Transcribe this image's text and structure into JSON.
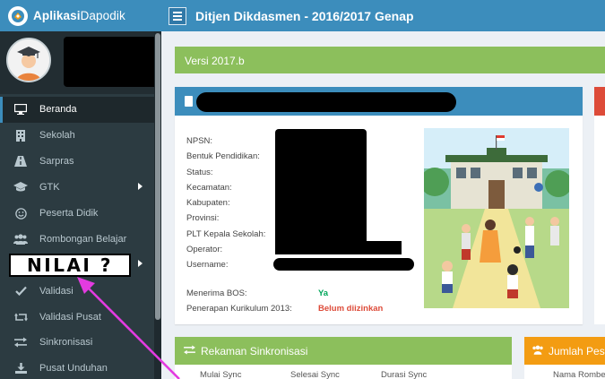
{
  "app": {
    "logo_bold": "Aplikasi",
    "logo_rest": "Dapodik",
    "page_title": "Ditjen Dikdasmen - 2016/2017 Genap"
  },
  "sidebar": {
    "items": [
      {
        "label": "Beranda",
        "icon": "desktop-icon"
      },
      {
        "label": "Sekolah",
        "icon": "building-icon"
      },
      {
        "label": "Sarpras",
        "icon": "road-icon"
      },
      {
        "label": "GTK",
        "icon": "graduation-cap-icon"
      },
      {
        "label": "Peserta Didik",
        "icon": "smile-icon"
      },
      {
        "label": "Rombongan Belajar",
        "icon": "users-icon"
      },
      {
        "label": "",
        "icon": ""
      },
      {
        "label": "Validasi",
        "icon": "check-icon"
      },
      {
        "label": "Validasi Pusat",
        "icon": "retweet-icon"
      },
      {
        "label": "Sinkronisasi",
        "icon": "exchange-icon"
      },
      {
        "label": "Pusat Unduhan",
        "icon": "download-icon"
      }
    ]
  },
  "version": {
    "label": "Versi 2017.b"
  },
  "school": {
    "labels": [
      "NPSN:",
      "Bentuk Pendidikan:",
      "Status:",
      "Kecamatan:",
      "Kabupaten:",
      "Provinsi:",
      "PLT Kepala Sekolah:",
      "Operator:",
      "Username:"
    ],
    "bos_label": "Menerima BOS:",
    "bos_value": "Ya",
    "kurikulum_label": "Penerapan Kurikulum 2013:",
    "kurikulum_value": "Belum diizinkan"
  },
  "sync": {
    "title": "Rekaman Sinkronisasi",
    "cols": [
      "Mulai Sync",
      "Selesai Sync",
      "Durasi Sync"
    ]
  },
  "count": {
    "title": "Jumlah Peserta",
    "cols": [
      "Nama Rombel"
    ]
  },
  "annotation": {
    "text": "NILAI ?"
  },
  "colors": {
    "header": "#3c8dbc",
    "sidebar": "#2c3b41",
    "green": "#8cbf5c",
    "red": "#dd4b39",
    "orange": "#f39c12",
    "arrow": "#e33be0"
  }
}
